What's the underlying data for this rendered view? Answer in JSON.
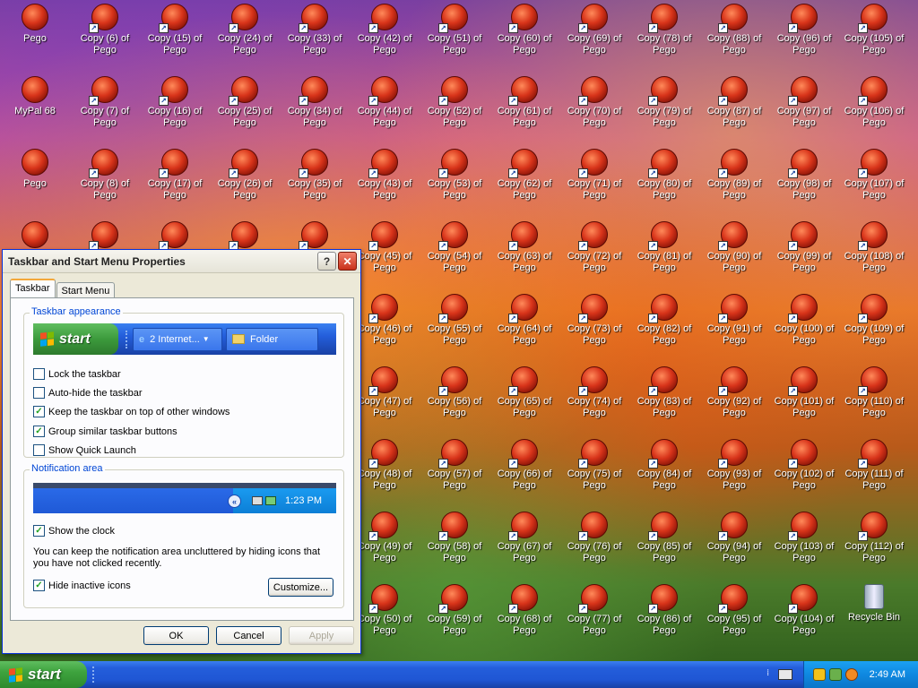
{
  "desktop": {
    "icons": [
      {
        "label": "Pego",
        "shortcut": false
      },
      {
        "label": "Copy (6) of Pego",
        "shortcut": true
      },
      {
        "label": "Copy (15) of Pego",
        "shortcut": true
      },
      {
        "label": "Copy (24) of Pego",
        "shortcut": true
      },
      {
        "label": "Copy (33) of Pego",
        "shortcut": true
      },
      {
        "label": "Copy (42) of Pego",
        "shortcut": true
      },
      {
        "label": "Copy (51) of Pego",
        "shortcut": true
      },
      {
        "label": "Copy (60) of Pego",
        "shortcut": true
      },
      {
        "label": "Copy (69) of Pego",
        "shortcut": true
      },
      {
        "label": "Copy (78) of Pego",
        "shortcut": true
      },
      {
        "label": "Copy (88) of Pego",
        "shortcut": true
      },
      {
        "label": "Copy (96) of Pego",
        "shortcut": true
      },
      {
        "label": "Copy (105) of Pego",
        "shortcut": true
      },
      {
        "label": "MyPal 68",
        "shortcut": false
      },
      {
        "label": "Copy (7) of Pego",
        "shortcut": true
      },
      {
        "label": "Copy (16) of Pego",
        "shortcut": true
      },
      {
        "label": "Copy (25) of Pego",
        "shortcut": true
      },
      {
        "label": "Copy (34) of Pego",
        "shortcut": true
      },
      {
        "label": "Copy (44) of Pego",
        "shortcut": true
      },
      {
        "label": "Copy (52) of Pego",
        "shortcut": true
      },
      {
        "label": "Copy (61) of Pego",
        "shortcut": true
      },
      {
        "label": "Copy (70) of Pego",
        "shortcut": true
      },
      {
        "label": "Copy (79) of Pego",
        "shortcut": true
      },
      {
        "label": "Copy (87) of Pego",
        "shortcut": true
      },
      {
        "label": "Copy (97) of Pego",
        "shortcut": true
      },
      {
        "label": "Copy (106) of Pego",
        "shortcut": true
      },
      {
        "label": "Pego",
        "shortcut": false
      },
      {
        "label": "Copy (8) of Pego",
        "shortcut": true
      },
      {
        "label": "Copy (17) of Pego",
        "shortcut": true
      },
      {
        "label": "Copy (26) of Pego",
        "shortcut": true
      },
      {
        "label": "Copy (35) of Pego",
        "shortcut": true
      },
      {
        "label": "Copy (43) of Pego",
        "shortcut": true
      },
      {
        "label": "Copy (53) of Pego",
        "shortcut": true
      },
      {
        "label": "Copy (62) of Pego",
        "shortcut": true
      },
      {
        "label": "Copy (71) of Pego",
        "shortcut": true
      },
      {
        "label": "Copy (80) of Pego",
        "shortcut": true
      },
      {
        "label": "Copy (89) of Pego",
        "shortcut": true
      },
      {
        "label": "Copy (98) of Pego",
        "shortcut": true
      },
      {
        "label": "Copy (107) of Pego",
        "shortcut": true
      },
      {
        "label": "",
        "shortcut": false
      },
      {
        "label": "",
        "shortcut": true
      },
      {
        "label": "",
        "shortcut": true
      },
      {
        "label": "",
        "shortcut": true
      },
      {
        "label": "",
        "shortcut": true
      },
      {
        "label": "Copy (45) of Pego",
        "shortcut": true
      },
      {
        "label": "Copy (54) of Pego",
        "shortcut": true
      },
      {
        "label": "Copy (63) of Pego",
        "shortcut": true
      },
      {
        "label": "Copy (72) of Pego",
        "shortcut": true
      },
      {
        "label": "Copy (81) of Pego",
        "shortcut": true
      },
      {
        "label": "Copy (90) of Pego",
        "shortcut": true
      },
      {
        "label": "Copy (99) of Pego",
        "shortcut": true
      },
      {
        "label": "Copy (108) of Pego",
        "shortcut": true
      },
      {
        "label": "Copy (46) of Pego",
        "shortcut": true
      },
      {
        "label": "Copy (55) of Pego",
        "shortcut": true
      },
      {
        "label": "Copy (64) of Pego",
        "shortcut": true
      },
      {
        "label": "Copy (73) of Pego",
        "shortcut": true
      },
      {
        "label": "Copy (82) of Pego",
        "shortcut": true
      },
      {
        "label": "Copy (91) of Pego",
        "shortcut": true
      },
      {
        "label": "Copy (100) of Pego",
        "shortcut": true
      },
      {
        "label": "Copy (109) of Pego",
        "shortcut": true
      },
      {
        "label": "Copy (47) of Pego",
        "shortcut": true
      },
      {
        "label": "Copy (56) of Pego",
        "shortcut": true
      },
      {
        "label": "Copy (65) of Pego",
        "shortcut": true
      },
      {
        "label": "Copy (74) of Pego",
        "shortcut": true
      },
      {
        "label": "Copy (83) of Pego",
        "shortcut": true
      },
      {
        "label": "Copy (92) of Pego",
        "shortcut": true
      },
      {
        "label": "Copy (101) of Pego",
        "shortcut": true
      },
      {
        "label": "Copy (110) of Pego",
        "shortcut": true
      },
      {
        "label": "Copy (48) of Pego",
        "shortcut": true
      },
      {
        "label": "Copy (57) of Pego",
        "shortcut": true
      },
      {
        "label": "Copy (66) of Pego",
        "shortcut": true
      },
      {
        "label": "Copy (75) of Pego",
        "shortcut": true
      },
      {
        "label": "Copy (84) of Pego",
        "shortcut": true
      },
      {
        "label": "Copy (93) of Pego",
        "shortcut": true
      },
      {
        "label": "Copy (102) of Pego",
        "shortcut": true
      },
      {
        "label": "Copy (111) of Pego",
        "shortcut": true
      },
      {
        "label": "Copy (49) of Pego",
        "shortcut": true
      },
      {
        "label": "Copy (58) of Pego",
        "shortcut": true
      },
      {
        "label": "Copy (67) of Pego",
        "shortcut": true
      },
      {
        "label": "Copy (76) of Pego",
        "shortcut": true
      },
      {
        "label": "Copy (85) of Pego",
        "shortcut": true
      },
      {
        "label": "Copy (94) of Pego",
        "shortcut": true
      },
      {
        "label": "Copy (103) of Pego",
        "shortcut": true
      },
      {
        "label": "Copy (112) of Pego",
        "shortcut": true
      },
      {
        "label": "Copy (50) of Pego",
        "shortcut": true
      },
      {
        "label": "Copy (59) of Pego",
        "shortcut": true
      },
      {
        "label": "Copy (68) of Pego",
        "shortcut": true
      },
      {
        "label": "Copy (77) of Pego",
        "shortcut": true
      },
      {
        "label": "Copy (86) of Pego",
        "shortcut": true
      },
      {
        "label": "Copy (95) of Pego",
        "shortcut": true
      },
      {
        "label": "Copy (104) of Pego",
        "shortcut": true
      },
      {
        "label": "Recycle Bin",
        "shortcut": false
      }
    ]
  },
  "dialog": {
    "title": "Taskbar and Start Menu Properties",
    "help_label": "?",
    "close_label": "✕",
    "tabs": [
      {
        "label": "Taskbar"
      },
      {
        "label": "Start Menu"
      }
    ],
    "appearance": {
      "title": "Taskbar appearance",
      "preview_start": "start",
      "preview_btn1": "2 Internet...",
      "preview_btn2": "Folder",
      "options": [
        {
          "label": "Lock the taskbar",
          "checked": false
        },
        {
          "label": "Auto-hide the taskbar",
          "checked": false
        },
        {
          "label": "Keep the taskbar on top of other windows",
          "checked": true
        },
        {
          "label": "Group similar taskbar buttons",
          "checked": true
        },
        {
          "label": "Show Quick Launch",
          "checked": false
        }
      ]
    },
    "notification": {
      "title": "Notification area",
      "preview_time": "1:23 PM",
      "show_clock": {
        "label": "Show the clock",
        "checked": true
      },
      "description": "You can keep the notification area uncluttered by hiding icons that you have not clicked recently.",
      "hide_inactive": {
        "label": "Hide inactive icons",
        "checked": true
      },
      "customize_label": "Customize..."
    },
    "buttons": {
      "ok": "OK",
      "cancel": "Cancel",
      "apply": "Apply"
    }
  },
  "taskbar": {
    "start_label": "start",
    "clock": "2:49 AM"
  }
}
